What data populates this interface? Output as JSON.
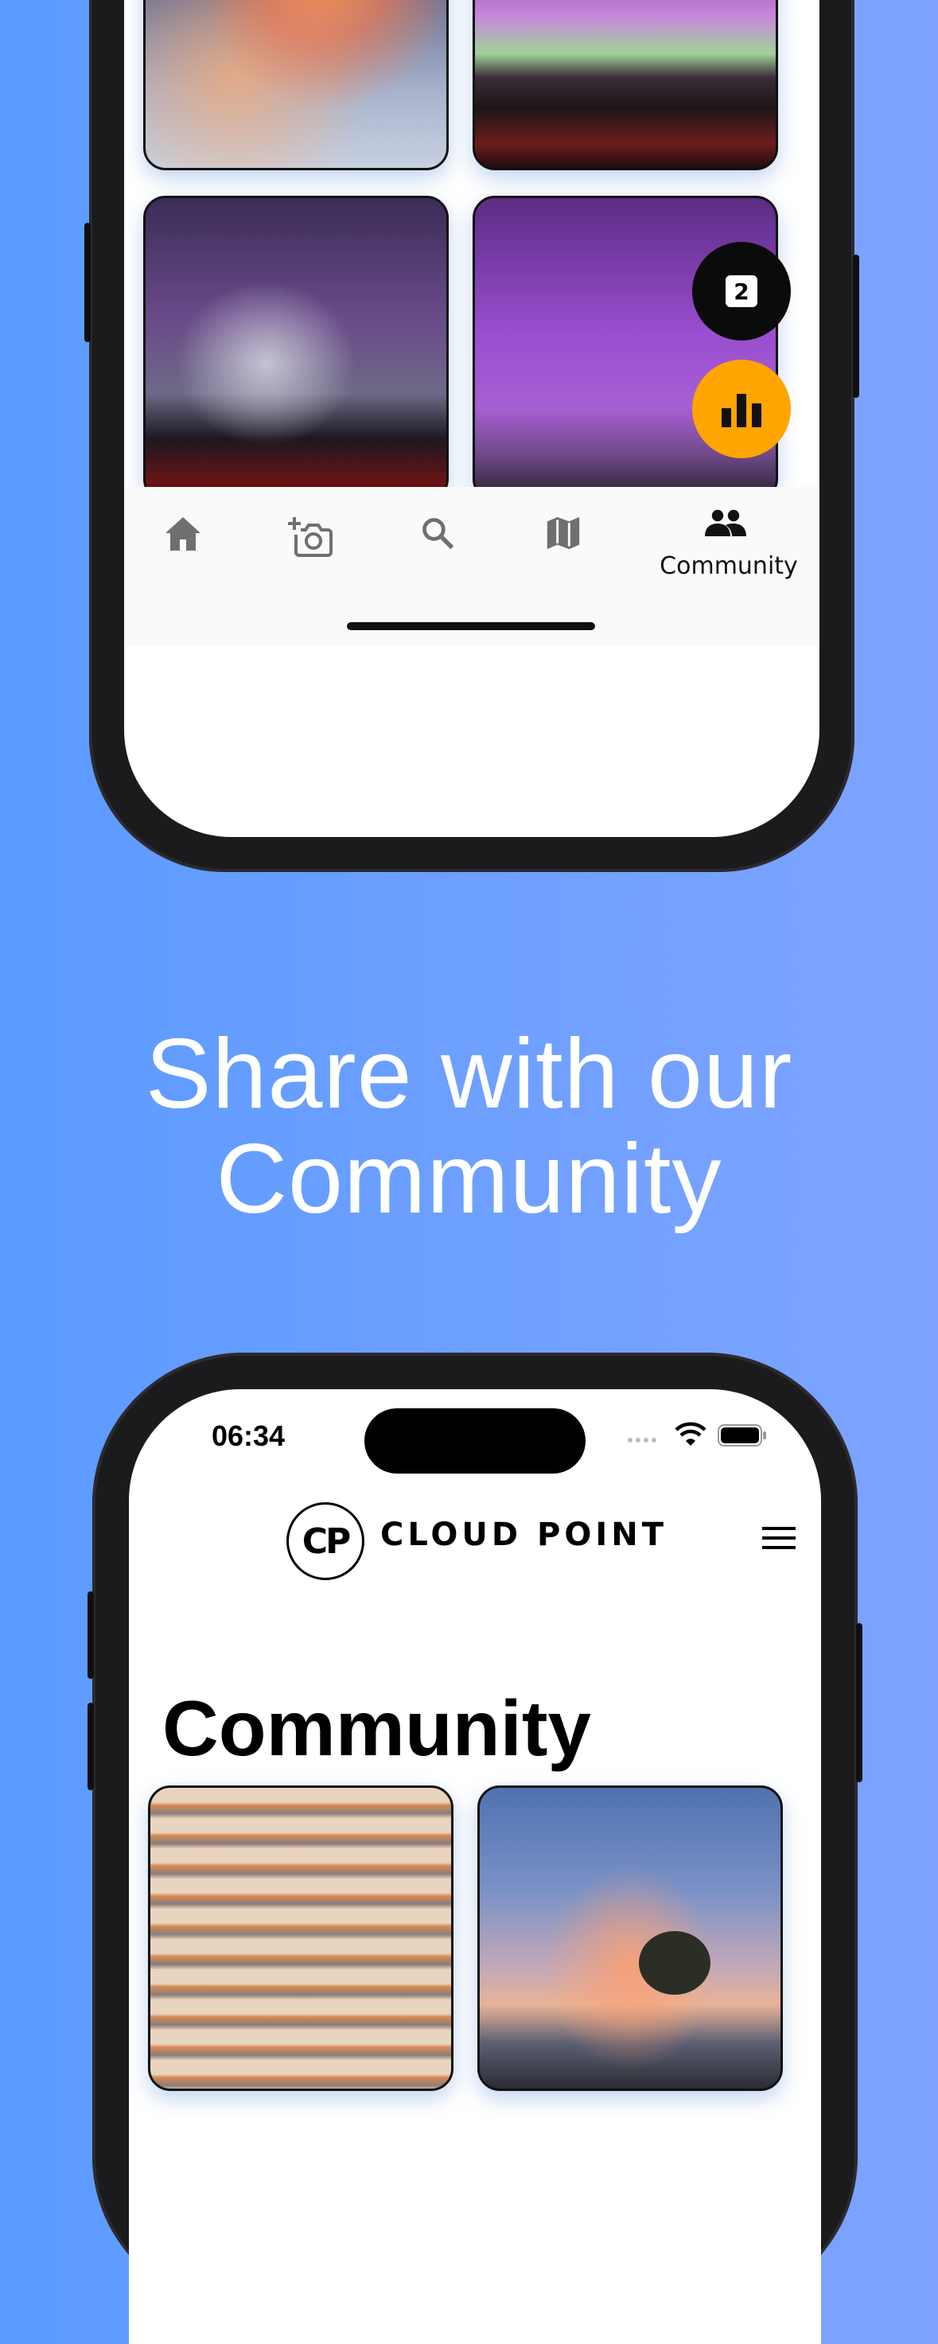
{
  "headline": {
    "line1": "Share with our",
    "line2": "Community"
  },
  "top_phone": {
    "nav": {
      "items": [
        {
          "icon": "home-icon"
        },
        {
          "icon": "add-photo-icon"
        },
        {
          "icon": "search-icon"
        },
        {
          "icon": "map-icon"
        },
        {
          "icon": "community-icon",
          "label": "Community"
        }
      ],
      "active": "Community"
    },
    "fab_counter": {
      "value": "2"
    },
    "fab_stats": {
      "icon": "bar-chart-icon",
      "color": "#FFA500"
    }
  },
  "bottom_phone": {
    "status": {
      "time": "06:34"
    },
    "header": {
      "logo_initials": "CP",
      "brand": "CLOUD POINT",
      "menu_icon": "hamburger-menu-icon"
    },
    "page_title": "Community"
  },
  "colors": {
    "background_start": "#5b9bff",
    "background_end": "#7fa3ff",
    "accent": "#FFA500"
  }
}
